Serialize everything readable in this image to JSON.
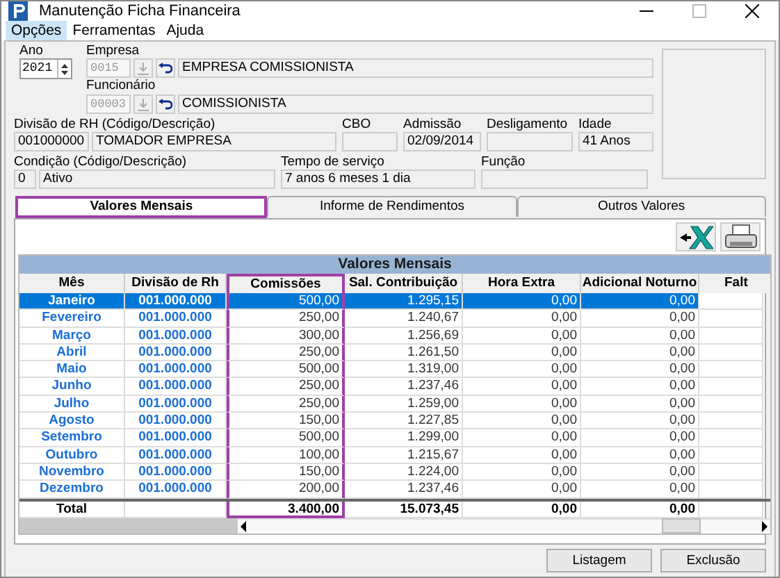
{
  "window": {
    "title": "Manutenção Ficha Financeira"
  },
  "menu": [
    {
      "label": "Opções",
      "selected": true
    },
    {
      "label": "Ferramentas",
      "selected": false
    },
    {
      "label": "Ajuda",
      "selected": false
    }
  ],
  "form": {
    "ano": {
      "label": "Ano",
      "value": "2021"
    },
    "empresa": {
      "label": "Empresa",
      "code": "0015",
      "name": "EMPRESA COMISSIONISTA"
    },
    "funcionario": {
      "label": "Funcionário",
      "code": "00003",
      "name": "COMISSIONISTA"
    },
    "divisao": {
      "label": "Divisão de RH (Código/Descrição)",
      "code": "001000000",
      "name": "TOMADOR EMPRESA"
    },
    "cbo": {
      "label": "CBO"
    },
    "admissao": {
      "label": "Admissão",
      "value": "02/09/2014"
    },
    "desligamento": {
      "label": "Desligamento"
    },
    "idade": {
      "label": "Idade",
      "value": "41 Anos"
    },
    "condicao": {
      "label": "Condição (Código/Descrição)",
      "code": "0",
      "name": "Ativo"
    },
    "tempo": {
      "label": "Tempo de serviço",
      "value": "7 anos 6 meses 1 dia"
    },
    "funcao": {
      "label": "Função"
    }
  },
  "tabs": [
    {
      "label": "Valores Mensais",
      "selected": true
    },
    {
      "label": "Informe de Rendimentos",
      "selected": false
    },
    {
      "label": "Outros Valores",
      "selected": false
    }
  ],
  "table": {
    "title": "Valores Mensais",
    "columns": [
      {
        "label": "Mês",
        "highlighted": false
      },
      {
        "label": "Divisão de Rh",
        "highlighted": false
      },
      {
        "label": "Comissões",
        "highlighted": true
      },
      {
        "label": "Sal. Contribuição",
        "highlighted": false
      },
      {
        "label": "Hora Extra",
        "highlighted": false
      },
      {
        "label": "Adicional Noturno",
        "highlighted": false
      },
      {
        "label": "Falt",
        "highlighted": false
      }
    ],
    "rows": [
      {
        "cells": [
          "Janeiro",
          "001.000.000",
          "500,00",
          "1.295,15",
          "0,00",
          "0,00"
        ],
        "selected": true
      },
      {
        "cells": [
          "Fevereiro",
          "001.000.000",
          "250,00",
          "1.240,67",
          "0,00",
          "0,00"
        ],
        "selected": false
      },
      {
        "cells": [
          "Março",
          "001.000.000",
          "300,00",
          "1.256,69",
          "0,00",
          "0,00"
        ],
        "selected": false
      },
      {
        "cells": [
          "Abril",
          "001.000.000",
          "250,00",
          "1.261,50",
          "0,00",
          "0,00"
        ],
        "selected": false
      },
      {
        "cells": [
          "Maio",
          "001.000.000",
          "500,00",
          "1.319,00",
          "0,00",
          "0,00"
        ],
        "selected": false
      },
      {
        "cells": [
          "Junho",
          "001.000.000",
          "250,00",
          "1.237,46",
          "0,00",
          "0,00"
        ],
        "selected": false
      },
      {
        "cells": [
          "Julho",
          "001.000.000",
          "250,00",
          "1.259,00",
          "0,00",
          "0,00"
        ],
        "selected": false
      },
      {
        "cells": [
          "Agosto",
          "001.000.000",
          "150,00",
          "1.227,85",
          "0,00",
          "0,00"
        ],
        "selected": false
      },
      {
        "cells": [
          "Setembro",
          "001.000.000",
          "500,00",
          "1.299,00",
          "0,00",
          "0,00"
        ],
        "selected": false
      },
      {
        "cells": [
          "Outubro",
          "001.000.000",
          "100,00",
          "1.215,67",
          "0,00",
          "0,00"
        ],
        "selected": false
      },
      {
        "cells": [
          "Novembro",
          "001.000.000",
          "150,00",
          "1.224,00",
          "0,00",
          "0,00"
        ],
        "selected": false
      },
      {
        "cells": [
          "Dezembro",
          "001.000.000",
          "200,00",
          "1.237,46",
          "0,00",
          "0,00"
        ],
        "selected": false
      }
    ],
    "total": {
      "label": "Total",
      "values": [
        "3.400,00",
        "15.073,45",
        "0,00",
        "0,00"
      ]
    }
  },
  "buttons": [
    "Listagem",
    "Exclusão"
  ]
}
